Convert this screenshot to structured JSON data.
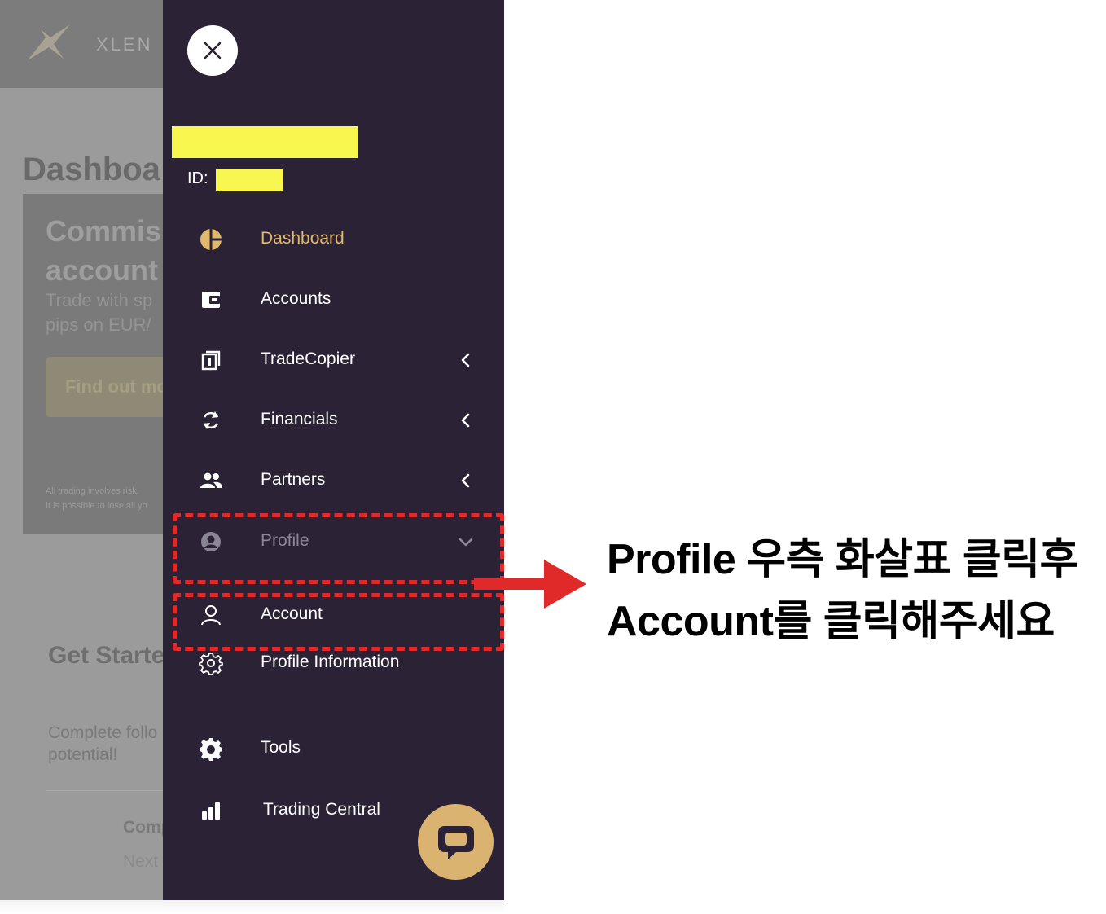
{
  "background": {
    "brand": "XLEN",
    "page_title": "Dashboa",
    "card_heading": "Commis\naccount",
    "card_text": "Trade with sp\npips on EUR/",
    "card_button": "Find out mo",
    "risk_text": "All trading involves risk.\nIt is possible to lose all yo",
    "get_started": "Get Starte",
    "complete_text": "Complete follo\npotential!",
    "comp_label": "Comp",
    "next_label": "Next"
  },
  "drawer": {
    "id_label": "ID:",
    "nav": [
      {
        "label": "Dashboard",
        "icon": "pie-chart-icon",
        "active": true
      },
      {
        "label": "Accounts",
        "icon": "wallet-icon"
      },
      {
        "label": "TradeCopier",
        "icon": "copier-icon",
        "chevron": "left"
      },
      {
        "label": "Financials",
        "icon": "refresh-icon",
        "chevron": "left"
      },
      {
        "label": "Partners",
        "icon": "people-icon",
        "chevron": "left"
      },
      {
        "label": "Profile",
        "icon": "user-circle-icon",
        "chevron": "down",
        "expanded": true
      }
    ],
    "profile_sub": [
      {
        "label": "Account",
        "icon": "user-outline-icon"
      },
      {
        "label": "Profile Information",
        "icon": "gear-outline-icon"
      }
    ],
    "extra": [
      {
        "label": "Tools",
        "icon": "gear-filled-icon"
      },
      {
        "label": "Trading Central",
        "icon": "bar-chart-icon"
      }
    ],
    "chat_icon": "chat-bubble-icon"
  },
  "annotation": {
    "line1": "Profile 우측 화살표 클릭후",
    "line2": "Account를 클릭해주세요",
    "highlight_color": "#e02a2a"
  },
  "colors": {
    "drawer_bg": "#2b2236",
    "accent_gold": "#e0b96e",
    "redaction": "#f7f74f"
  }
}
